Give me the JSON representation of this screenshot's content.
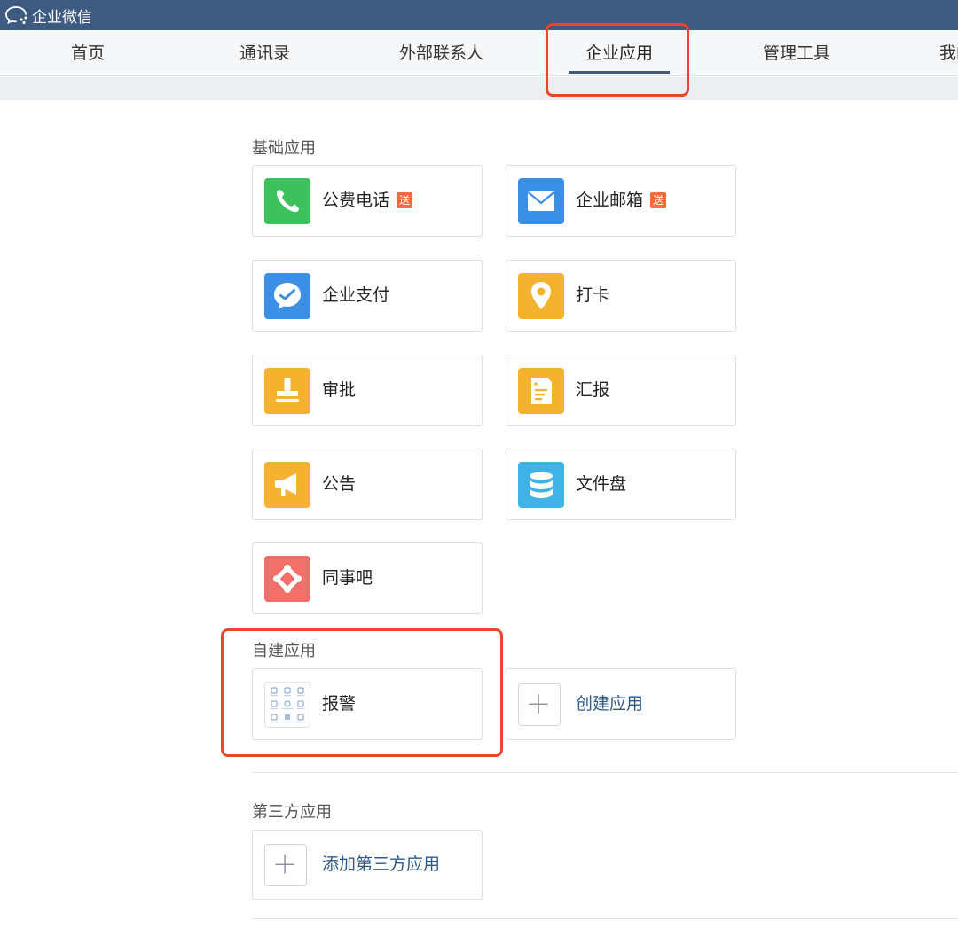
{
  "window": {
    "title": "企业微信"
  },
  "nav": {
    "tabs": [
      {
        "label": "首页"
      },
      {
        "label": "通讯录"
      },
      {
        "label": "外部联系人"
      },
      {
        "label": "企业应用"
      },
      {
        "label": "管理工具"
      },
      {
        "label": "我的"
      }
    ],
    "active_tab": "企业应用"
  },
  "sections": {
    "basic": {
      "title": "基础应用",
      "apps": [
        {
          "name": "公费电话",
          "badge": "送",
          "icon": "phone-icon",
          "color": "#3dc15d"
        },
        {
          "name": "企业邮箱",
          "badge": "送",
          "icon": "mail-icon",
          "color": "#3b8fe4"
        },
        {
          "name": "企业支付",
          "icon": "payment-icon",
          "color": "#3b8fe4"
        },
        {
          "name": "打卡",
          "icon": "location-pin-icon",
          "color": "#f5b22e"
        },
        {
          "name": "审批",
          "icon": "stamp-icon",
          "color": "#f5b22e"
        },
        {
          "name": "汇报",
          "icon": "report-icon",
          "color": "#f5b22e"
        },
        {
          "name": "公告",
          "icon": "megaphone-icon",
          "color": "#f5b22e"
        },
        {
          "name": "文件盘",
          "icon": "database-icon",
          "color": "#3fb2e6"
        },
        {
          "name": "同事吧",
          "icon": "network-icon",
          "color": "#f26f6a"
        }
      ]
    },
    "custom": {
      "title": "自建应用",
      "apps": [
        {
          "name": "报警",
          "icon": "alarm-app-icon"
        },
        {
          "name": "创建应用",
          "icon": "plus-icon"
        }
      ]
    },
    "third_party": {
      "title": "第三方应用",
      "apps": [
        {
          "name": "添加第三方应用",
          "icon": "plus-icon"
        }
      ]
    }
  },
  "colors": {
    "titlebar": "#3d5a80",
    "highlight": "#e9462c",
    "badge": "#f36b36",
    "link": "#2b5a8a"
  }
}
